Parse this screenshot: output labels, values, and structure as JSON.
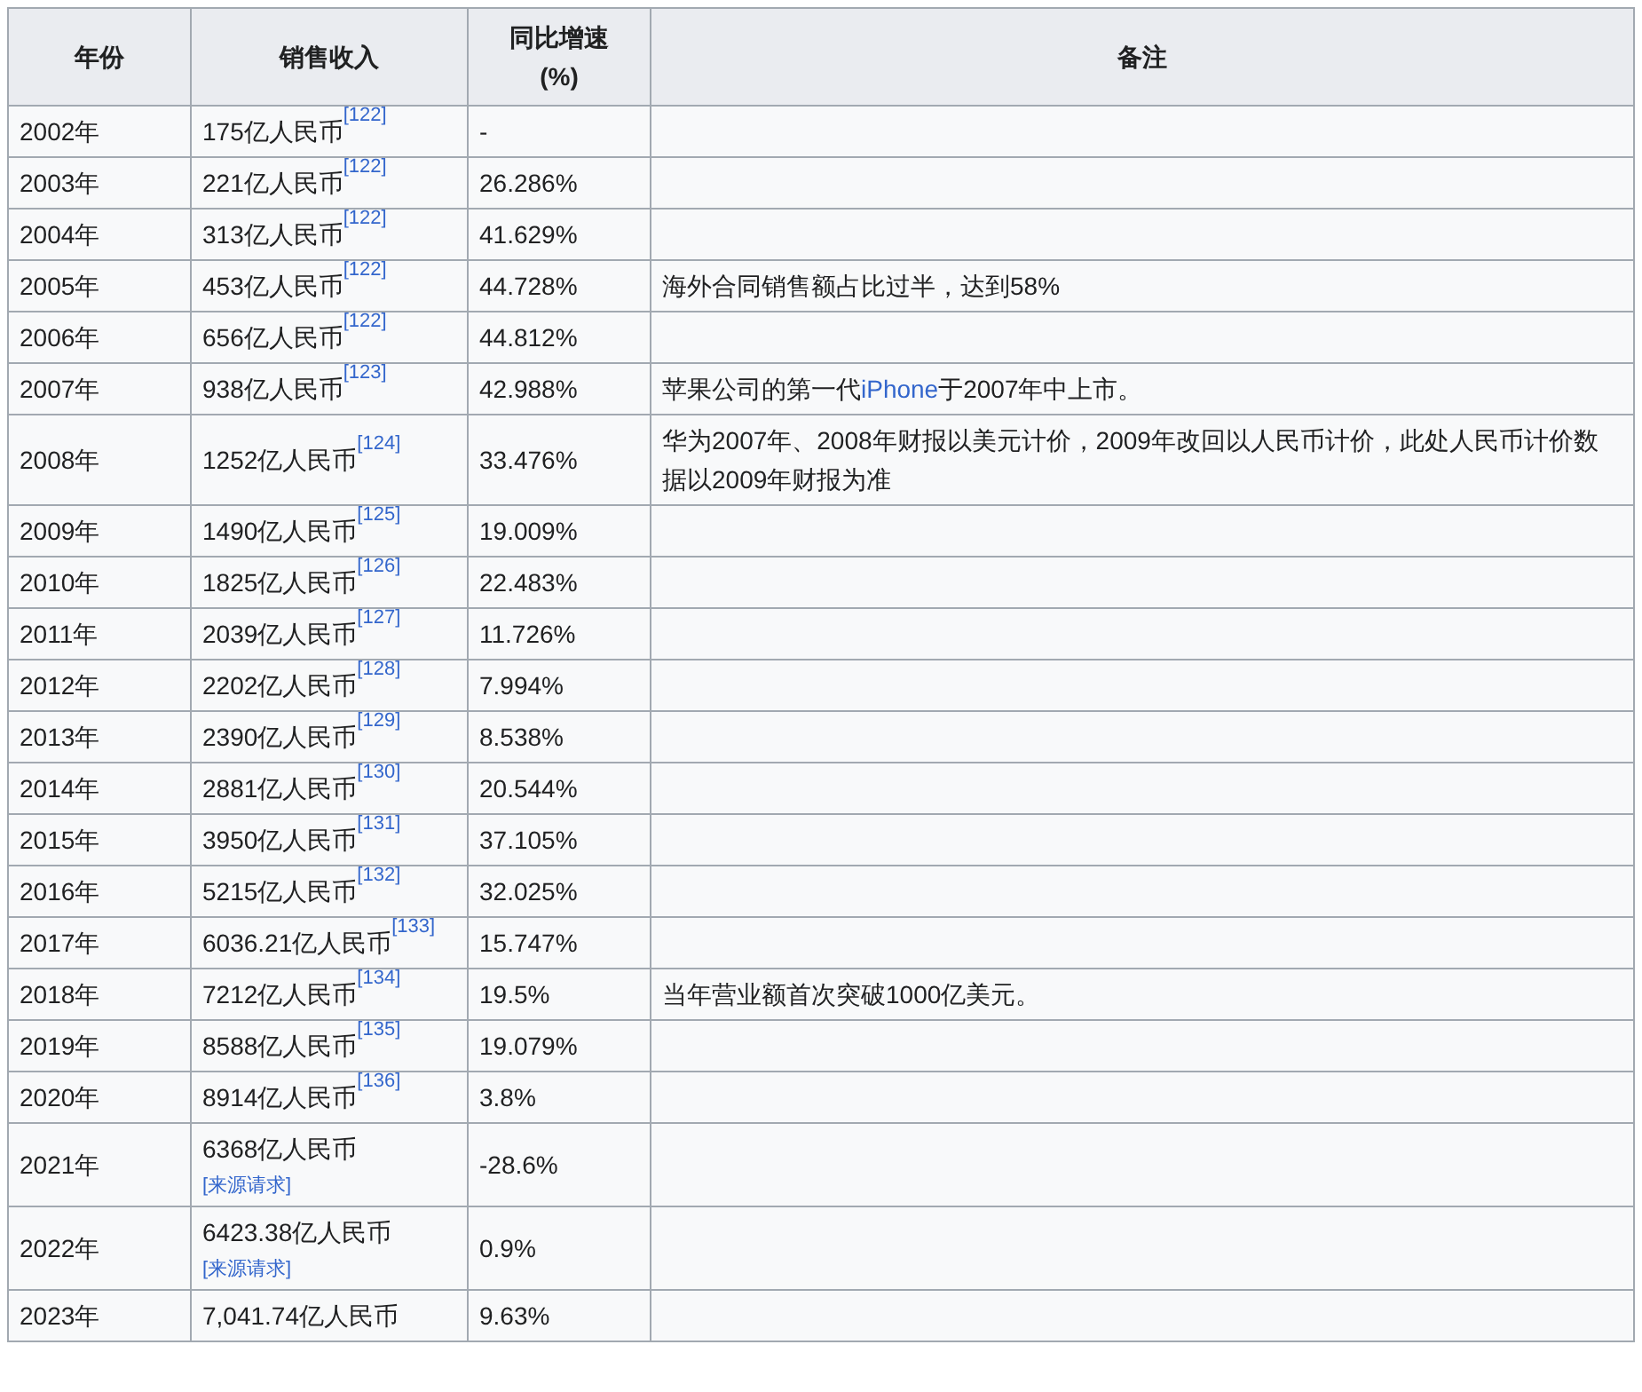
{
  "table": {
    "columns": [
      "年份",
      "销售收入",
      "同比增速\n(%)",
      "备注"
    ],
    "rows": [
      {
        "year": "2002年",
        "revenue": "175亿人民币",
        "ref": "[122]",
        "growth": "-",
        "remark": []
      },
      {
        "year": "2003年",
        "revenue": "221亿人民币",
        "ref": "[122]",
        "growth": "26.286%",
        "remark": []
      },
      {
        "year": "2004年",
        "revenue": "313亿人民币",
        "ref": "[122]",
        "growth": "41.629%",
        "remark": []
      },
      {
        "year": "2005年",
        "revenue": "453亿人民币",
        "ref": "[122]",
        "growth": "44.728%",
        "remark": [
          {
            "kind": "text",
            "text": "海外合同销售额占比过半，达到58%"
          }
        ]
      },
      {
        "year": "2006年",
        "revenue": "656亿人民币",
        "ref": "[122]",
        "growth": "44.812%",
        "remark": []
      },
      {
        "year": "2007年",
        "revenue": "938亿人民币",
        "ref": "[123]",
        "growth": "42.988%",
        "remark": [
          {
            "kind": "text",
            "text": "苹果公司的第一代"
          },
          {
            "kind": "link",
            "text": "iPhone"
          },
          {
            "kind": "text",
            "text": "于2007年中上市。"
          }
        ]
      },
      {
        "year": "2008年",
        "revenue": "1252亿人民币",
        "ref": "[124]",
        "growth": "33.476%",
        "remark": [
          {
            "kind": "text",
            "text": "华为2007年、2008年财报以美元计价，2009年改回以人民币计价，此处人民币计价数据以2009年财报为准"
          }
        ]
      },
      {
        "year": "2009年",
        "revenue": "1490亿人民币",
        "ref": "[125]",
        "growth": "19.009%",
        "remark": []
      },
      {
        "year": "2010年",
        "revenue": "1825亿人民币",
        "ref": "[126]",
        "growth": "22.483%",
        "remark": []
      },
      {
        "year": "2011年",
        "revenue": "2039亿人民币",
        "ref": "[127]",
        "growth": "11.726%",
        "remark": []
      },
      {
        "year": "2012年",
        "revenue": "2202亿人民币",
        "ref": "[128]",
        "growth": "7.994%",
        "remark": []
      },
      {
        "year": "2013年",
        "revenue": "2390亿人民币",
        "ref": "[129]",
        "growth": "8.538%",
        "remark": []
      },
      {
        "year": "2014年",
        "revenue": "2881亿人民币",
        "ref": "[130]",
        "growth": "20.544%",
        "remark": []
      },
      {
        "year": "2015年",
        "revenue": "3950亿人民币",
        "ref": "[131]",
        "growth": "37.105%",
        "remark": []
      },
      {
        "year": "2016年",
        "revenue": "5215亿人民币",
        "ref": "[132]",
        "growth": "32.025%",
        "remark": []
      },
      {
        "year": "2017年",
        "revenue": "6036.21亿人民币",
        "ref": "[133]",
        "growth": "15.747%",
        "remark": []
      },
      {
        "year": "2018年",
        "revenue": "7212亿人民币",
        "ref": "[134]",
        "growth": "19.5%",
        "remark": [
          {
            "kind": "text",
            "text": "当年营业额首次突破1000亿美元。"
          }
        ]
      },
      {
        "year": "2019年",
        "revenue": "8588亿人民币",
        "ref": "[135]",
        "growth": "19.079%",
        "remark": []
      },
      {
        "year": "2020年",
        "revenue": "8914亿人民币",
        "ref": "[136]",
        "growth": "3.8%",
        "remark": []
      },
      {
        "year": "2021年",
        "revenue": "6368亿人民币",
        "citation_needed": "[来源请求]",
        "growth": "-28.6%",
        "remark": []
      },
      {
        "year": "2022年",
        "revenue": "6423.38亿人民币",
        "citation_needed": "[来源请求]",
        "growth": "0.9%",
        "remark": []
      },
      {
        "year": "2023年",
        "revenue": "7,041.74亿人民币",
        "growth": "9.63%",
        "remark": []
      }
    ]
  }
}
